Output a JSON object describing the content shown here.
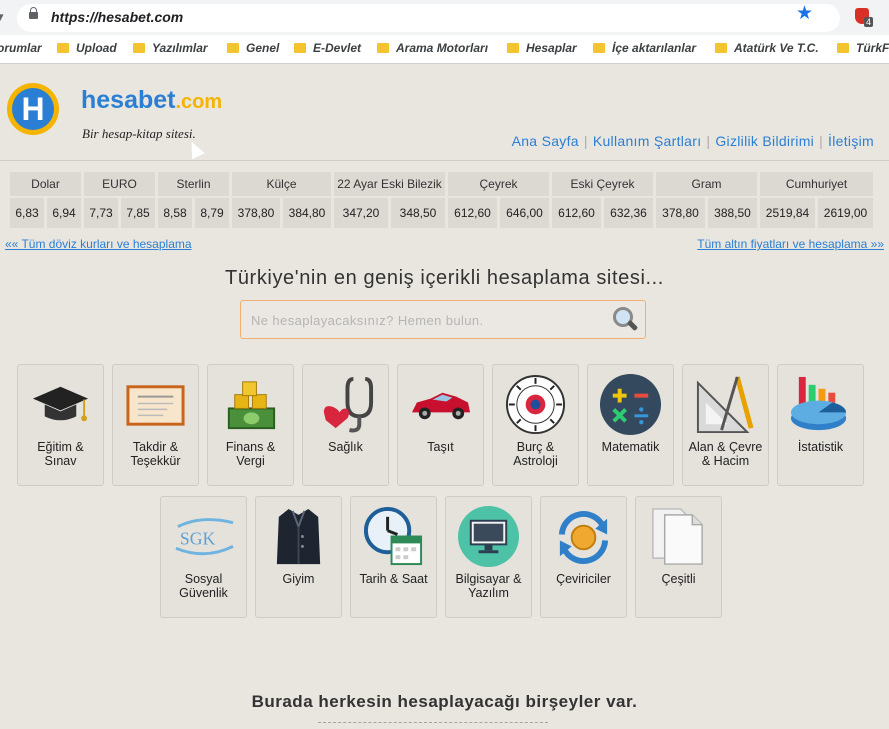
{
  "browser": {
    "url": "https://hesabet.com",
    "extension_badge": "4",
    "bookmarks": [
      "orumlar",
      "Upload",
      "Yazılımlar",
      "Genel",
      "E-Devlet",
      "Arama Motorları",
      "Hesaplar",
      "İçe aktarılanlar",
      "Atatürk Ve T.C.",
      "TürkFo"
    ]
  },
  "site": {
    "brand_name": "hesabet",
    "brand_tld": ".com",
    "slogan": "Bir hesap-kitap sitesi.",
    "nav": [
      "Ana Sayfa",
      "Kullanım Şartları",
      "Gizlilik Bildirimi",
      "İletişim"
    ]
  },
  "rates": {
    "headers": [
      {
        "label": "Dolar",
        "values": [
          "6,83",
          "6,94"
        ]
      },
      {
        "label": "EURO",
        "values": [
          "7,73",
          "7,85"
        ]
      },
      {
        "label": "Sterlin",
        "values": [
          "8,58",
          "8,79"
        ]
      },
      {
        "label": "Külçe",
        "values": [
          "378,80",
          "384,80"
        ]
      },
      {
        "label": "22 Ayar Eski Bilezik",
        "values": [
          "347,20",
          "348,50"
        ]
      },
      {
        "label": "Çeyrek",
        "values": [
          "612,60",
          "646,00"
        ]
      },
      {
        "label": "Eski Çeyrek",
        "values": [
          "612,60",
          "632,36"
        ]
      },
      {
        "label": "Gram",
        "values": [
          "378,80",
          "388,50"
        ]
      },
      {
        "label": "Cumhuriyet",
        "values": [
          "2519,84",
          "2619,00"
        ]
      }
    ],
    "link_left": "«« Tüm döviz kurları ve hesaplama",
    "link_right": "Tüm altın fiyatları ve hesaplama »»"
  },
  "main": {
    "headline": "Türkiye'nin en geniş içerikli hesaplama sitesi...",
    "search_placeholder": "Ne hesaplayacaksınız? Hemen bulun.",
    "categories_row1": [
      {
        "label": "Eğitim & Sınav",
        "icon": "graduation-cap-icon"
      },
      {
        "label": "Takdir & Teşekkür",
        "icon": "certificate-icon"
      },
      {
        "label": "Finans & Vergi",
        "icon": "money-icon"
      },
      {
        "label": "Sağlık",
        "icon": "stethoscope-icon"
      },
      {
        "label": "Taşıt",
        "icon": "car-icon"
      },
      {
        "label": "Burç & Astroloji",
        "icon": "zodiac-icon"
      },
      {
        "label": "Matematik",
        "icon": "math-icon"
      },
      {
        "label": "Alan & Çevre & Hacim",
        "icon": "geometry-icon"
      },
      {
        "label": "İstatistik",
        "icon": "statistics-icon"
      }
    ],
    "categories_row2": [
      {
        "label": "Sosyal Güvenlik",
        "icon": "sgk-icon"
      },
      {
        "label": "Giyim",
        "icon": "coat-icon"
      },
      {
        "label": "Tarih & Saat",
        "icon": "clock-calendar-icon"
      },
      {
        "label": "Bilgisayar & Yazılım",
        "icon": "computer-icon"
      },
      {
        "label": "Çeviriciler",
        "icon": "converter-icon"
      },
      {
        "label": "Çeşitli",
        "icon": "documents-icon"
      }
    ],
    "sgk_text": "SGK",
    "bottom_text": "Burada herkesin hesaplayacağı birşeyler var."
  }
}
